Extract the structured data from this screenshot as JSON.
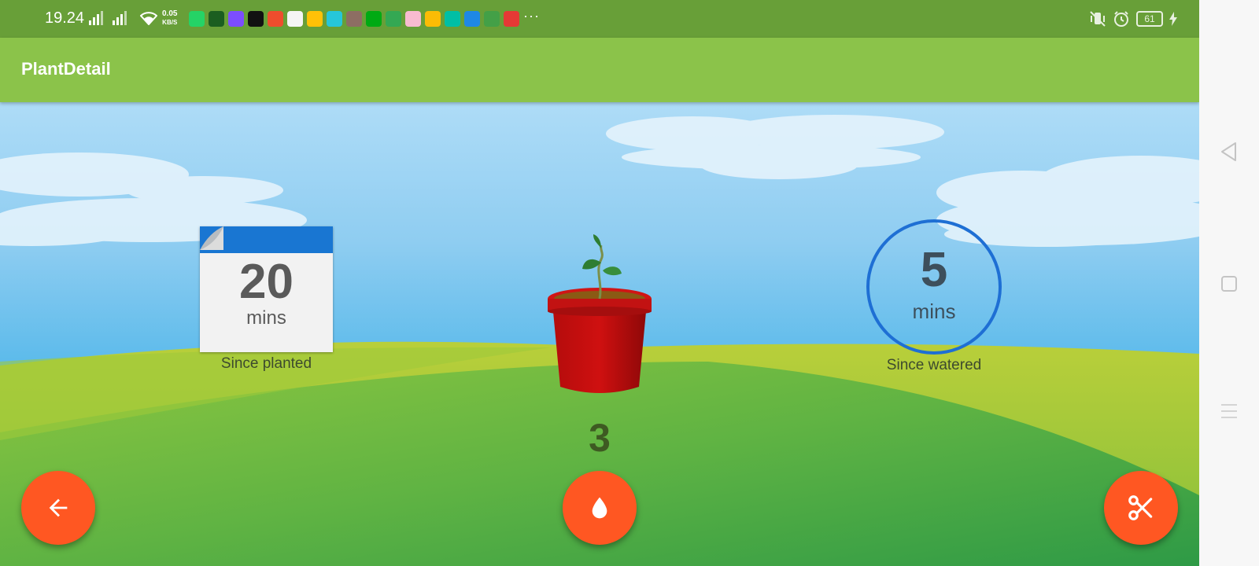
{
  "status_bar": {
    "time": "19.24",
    "net_speed_value": "0.05",
    "net_speed_unit": "KB/S",
    "battery_level": "61",
    "app_icons": [
      {
        "name": "whatsapp",
        "color": "#25d366"
      },
      {
        "name": "mosque-app",
        "color": "#1b5e20"
      },
      {
        "name": "diamond-app",
        "color": "#7c4dff"
      },
      {
        "name": "tiktok",
        "color": "#111111"
      },
      {
        "name": "shopee",
        "color": "#ee4d2d"
      },
      {
        "name": "lazada",
        "color": "#f5f5f5"
      },
      {
        "name": "yellow-app",
        "color": "#ffc107"
      },
      {
        "name": "cyan-app",
        "color": "#26c6da"
      },
      {
        "name": "game-app",
        "color": "#8d6e63"
      },
      {
        "name": "gojek",
        "color": "#00aa13"
      },
      {
        "name": "messages",
        "color": "#34a853"
      },
      {
        "name": "anime-app",
        "color": "#f8bbd0"
      },
      {
        "name": "pinwheel-app",
        "color": "#fbbc05"
      },
      {
        "name": "shield-app",
        "color": "#00bfa5"
      },
      {
        "name": "badge-app",
        "color": "#1e88e5"
      },
      {
        "name": "calendar-app",
        "color": "#43a047"
      },
      {
        "name": "red-app",
        "color": "#e53935"
      }
    ]
  },
  "app_bar": {
    "title": "PlantDetail"
  },
  "planted": {
    "value": "20",
    "unit": "mins",
    "label": "Since planted"
  },
  "watered": {
    "value": "5",
    "unit": "mins",
    "label": "Since watered"
  },
  "plant": {
    "count": "3"
  },
  "fabs": {
    "back_icon": "arrow-left-icon",
    "water_icon": "water-drop-icon",
    "cut_icon": "scissors-icon",
    "color": "#ff5722"
  },
  "nav_bar": {
    "back_icon": "triangle-back-icon",
    "home_icon": "square-home-icon",
    "menu_icon": "menu-lines-icon"
  }
}
